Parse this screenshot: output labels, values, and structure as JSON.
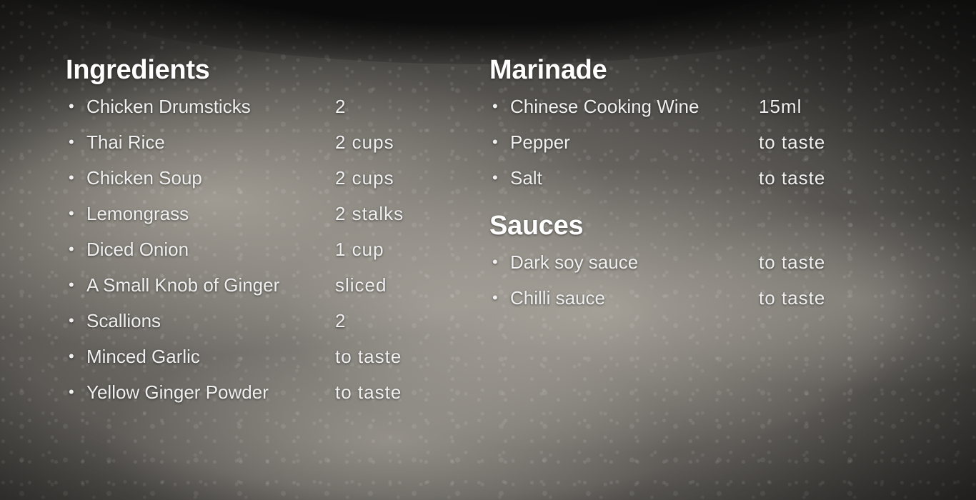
{
  "ingredients": {
    "title": "Ingredients",
    "items": [
      {
        "name": "Chicken Drumsticks",
        "qty": "2"
      },
      {
        "name": "Thai Rice",
        "qty": "2 cups"
      },
      {
        "name": "Chicken Soup",
        "qty": "2 cups"
      },
      {
        "name": "Lemongrass",
        "qty": "2 stalks"
      },
      {
        "name": "Diced Onion",
        "qty": "1 cup"
      },
      {
        "name": "A Small Knob of Ginger",
        "qty": "sliced"
      },
      {
        "name": "Scallions",
        "qty": "2"
      },
      {
        "name": "Minced Garlic",
        "qty": "to taste"
      },
      {
        "name": "Yellow Ginger Powder",
        "qty": "to taste"
      }
    ]
  },
  "marinade": {
    "title": "Marinade",
    "items": [
      {
        "name": "Chinese Cooking Wine",
        "qty": "15ml"
      },
      {
        "name": "Pepper",
        "qty": "to taste"
      },
      {
        "name": "Salt",
        "qty": "to taste"
      }
    ]
  },
  "sauces": {
    "title": "Sauces",
    "items": [
      {
        "name": "Dark soy sauce",
        "qty": "to taste"
      },
      {
        "name": "Chilli sauce",
        "qty": "to taste"
      }
    ]
  },
  "bullet": "•",
  "colors": {
    "text": "#f0f0f0",
    "heading": "#ffffff",
    "background": "#5e5b57"
  }
}
